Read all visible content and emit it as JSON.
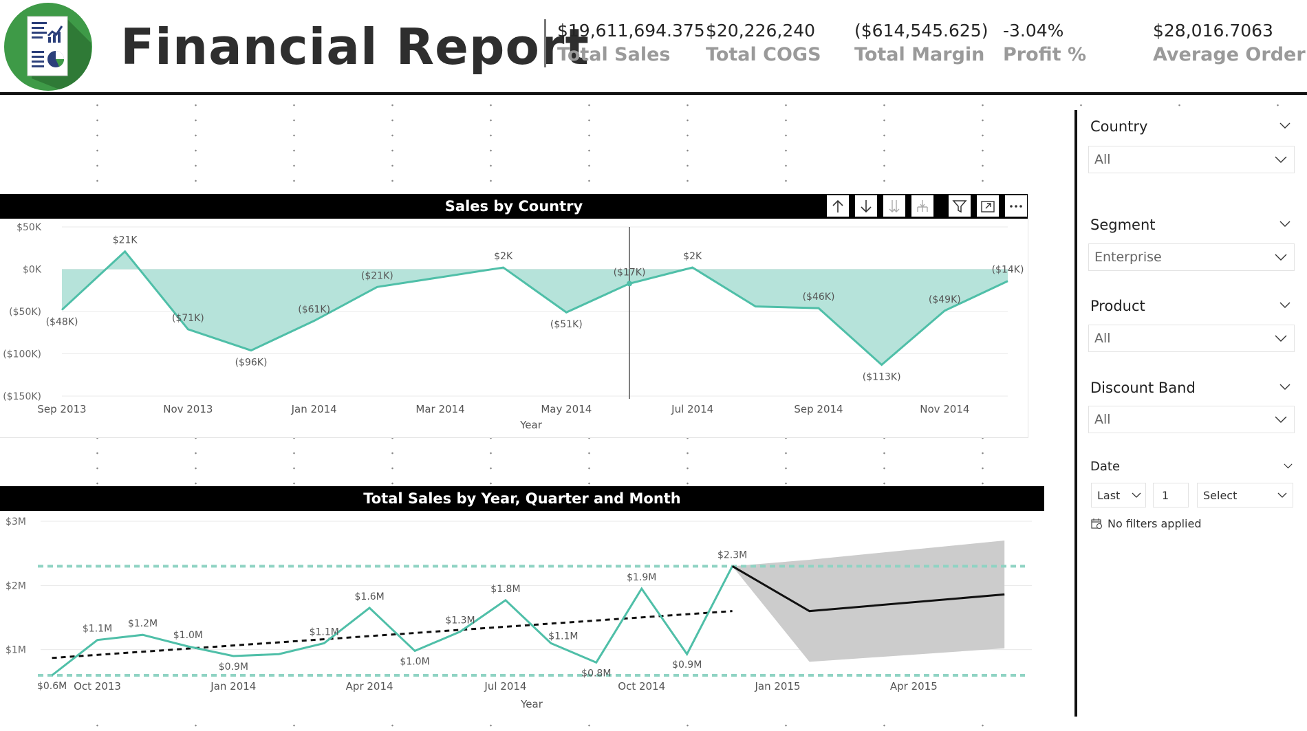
{
  "header": {
    "title": "Financial Report",
    "kpis": [
      {
        "value": "$19,611,694.375",
        "label": "Total Sales"
      },
      {
        "value": "$20,226,240",
        "label": "Total COGS"
      },
      {
        "value": "($614,545.625)",
        "label": "Total Margin"
      },
      {
        "value": "-3.04%",
        "label": "Profit %"
      },
      {
        "value": "$28,016.7063",
        "label": "Average Order"
      }
    ],
    "logo_icon": "report-document-icon"
  },
  "colors": {
    "accent": "#4fbfa8",
    "area_fill": "#b6e3da",
    "forecast_band": "#cccccc",
    "header_bg": "#000000"
  },
  "toolbar": {
    "icons": [
      "arrow-up-icon",
      "arrow-down-icon",
      "double-arrow-down-icon",
      "expand-hierarchy-icon",
      "filter-icon",
      "focus-mode-icon",
      "more-options-icon"
    ]
  },
  "slicers": {
    "country": {
      "title": "Country",
      "value": "All"
    },
    "segment": {
      "title": "Segment",
      "value": "Enterprise"
    },
    "product": {
      "title": "Product",
      "value": "All"
    },
    "discount_band": {
      "title": "Discount Band",
      "value": "All"
    },
    "date": {
      "title": "Date",
      "period": "Last",
      "count": "1",
      "unit": "Select",
      "status": "No filters applied"
    }
  },
  "chart_data": [
    {
      "type": "area",
      "title": "Sales by Country",
      "xlabel": "Year",
      "ylabel": "",
      "ylim": [
        -150000,
        50000
      ],
      "y_ticks": [
        "$50K",
        "$0K",
        "($50K)",
        "($100K)",
        "($150K)"
      ],
      "y_tick_values": [
        50000,
        0,
        -50000,
        -100000,
        -150000
      ],
      "x_ticks": [
        {
          "label": "Sep 2013",
          "x": 0
        },
        {
          "label": "Nov 2013",
          "x": 2
        },
        {
          "label": "Jan 2014",
          "x": 4
        },
        {
          "label": "Mar 2014",
          "x": 6
        },
        {
          "label": "May 2014",
          "x": 8
        },
        {
          "label": "Jul 2014",
          "x": 10
        },
        {
          "label": "Sep 2014",
          "x": 12
        },
        {
          "label": "Nov 2014",
          "x": 14
        }
      ],
      "series": [
        {
          "points": [
            {
              "x": 0,
              "y": -48000,
              "label": "($48K)",
              "label_pos": "below"
            },
            {
              "x": 1,
              "y": 21000,
              "label": "$21K",
              "label_pos": "above"
            },
            {
              "x": 2,
              "y": -71000,
              "label": "($71K)",
              "label_pos": "above"
            },
            {
              "x": 3,
              "y": -96000,
              "label": "($96K)",
              "label_pos": "below"
            },
            {
              "x": 4,
              "y": -61000,
              "label": "($61K)",
              "label_pos": "above"
            },
            {
              "x": 5,
              "y": -21000,
              "label": "($21K)",
              "label_pos": "above"
            },
            {
              "x": 7,
              "y": 2000,
              "label": "$2K",
              "label_pos": "above"
            },
            {
              "x": 8,
              "y": -51000,
              "label": "($51K)",
              "label_pos": "below"
            },
            {
              "x": 9,
              "y": -17000,
              "label": "($17K)",
              "label_pos": "above"
            },
            {
              "x": 10,
              "y": 2000,
              "label": "$2K",
              "label_pos": "above"
            },
            {
              "x": 11,
              "y": -44000,
              "label": "",
              "label_pos": "above"
            },
            {
              "x": 12,
              "y": -46000,
              "label": "($46K)",
              "label_pos": "above"
            },
            {
              "x": 13,
              "y": -113000,
              "label": "($113K)",
              "label_pos": "below"
            },
            {
              "x": 14,
              "y": -49000,
              "label": "($49K)",
              "label_pos": "above"
            },
            {
              "x": 15,
              "y": -14000,
              "label": "($14K)",
              "label_pos": "above"
            }
          ]
        }
      ],
      "hover_x": 9,
      "grid": true
    },
    {
      "type": "line",
      "title": "Total Sales by Year, Quarter and Month",
      "xlabel": "Year",
      "ylabel": "",
      "ylim": [
        0.3,
        3
      ],
      "y_ticks": [
        "$3M",
        "$2M",
        "$1M"
      ],
      "y_tick_values": [
        3,
        2,
        1
      ],
      "x_ticks": [
        {
          "label": "Oct 2013",
          "x": 1
        },
        {
          "label": "Jan 2014",
          "x": 4
        },
        {
          "label": "Apr 2014",
          "x": 7
        },
        {
          "label": "Jul 2014",
          "x": 10
        },
        {
          "label": "Oct 2014",
          "x": 13
        },
        {
          "label": "Jan 2015",
          "x": 16
        },
        {
          "label": "Apr 2015",
          "x": 19
        }
      ],
      "xlim": [
        -0.1,
        21.3
      ],
      "series": [
        {
          "points": [
            {
              "x": 0,
              "y": 0.6,
              "label": "$0.6M",
              "label_pos": "below"
            },
            {
              "x": 1,
              "y": 1.15,
              "label": "$1.1M",
              "label_pos": "above"
            },
            {
              "x": 2,
              "y": 1.23,
              "label": "$1.2M",
              "label_pos": "above"
            },
            {
              "x": 3,
              "y": 1.05,
              "label": "$1.0M",
              "label_pos": "above"
            },
            {
              "x": 4,
              "y": 0.9,
              "label": "$0.9M",
              "label_pos": "below"
            },
            {
              "x": 5,
              "y": 0.93,
              "label": "",
              "label_pos": "above"
            },
            {
              "x": 6,
              "y": 1.1,
              "label": "$1.1M",
              "label_pos": "above"
            },
            {
              "x": 7,
              "y": 1.65,
              "label": "$1.6M",
              "label_pos": "above"
            },
            {
              "x": 8,
              "y": 0.98,
              "label": "$1.0M",
              "label_pos": "below"
            },
            {
              "x": 9,
              "y": 1.28,
              "label": "$1.3M",
              "label_pos": "above"
            },
            {
              "x": 10,
              "y": 1.77,
              "label": "$1.8M",
              "label_pos": "above"
            },
            {
              "x": 11,
              "y": 1.1,
              "label": "$1.1M",
              "label_pos": "above-right"
            },
            {
              "x": 12,
              "y": 0.8,
              "label": "$0.8M",
              "label_pos": "below"
            },
            {
              "x": 13,
              "y": 1.95,
              "label": "$1.9M",
              "label_pos": "above"
            },
            {
              "x": 14,
              "y": 0.93,
              "label": "$0.9M",
              "label_pos": "below"
            },
            {
              "x": 15,
              "y": 2.3,
              "label": "$2.3M",
              "label_pos": "above"
            }
          ]
        }
      ],
      "trend_line": {
        "x0": 0,
        "y0": 0.87,
        "x1": 15,
        "y1": 1.6
      },
      "min_line": 0.6,
      "max_line": 2.3,
      "forecast": {
        "points": [
          {
            "x": 15,
            "y": 2.3
          },
          {
            "x": 16.7,
            "y": 1.6
          },
          {
            "x": 21,
            "y": 1.86
          }
        ],
        "upper": [
          {
            "x": 15,
            "y": 2.3
          },
          {
            "x": 16.7,
            "y": 2.4
          },
          {
            "x": 21,
            "y": 2.7
          }
        ],
        "lower": [
          {
            "x": 15,
            "y": 2.3
          },
          {
            "x": 16.7,
            "y": 0.81
          },
          {
            "x": 21,
            "y": 1.02
          }
        ]
      },
      "grid": true
    }
  ]
}
